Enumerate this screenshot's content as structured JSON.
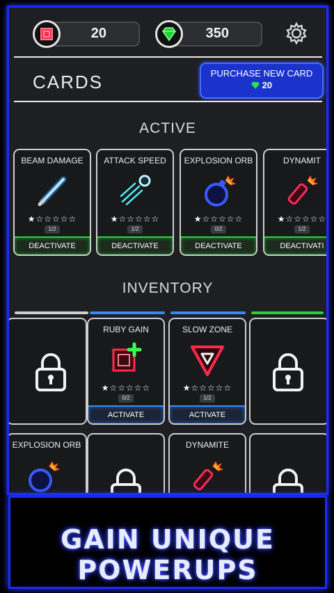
{
  "header": {
    "ruby_count": "20",
    "gem_count": "350",
    "ruby_icon": "ruby-icon",
    "gem_icon": "emerald-icon",
    "settings_icon": "gear-icon"
  },
  "page": {
    "title": "CARDS",
    "purchase_label": "PURCHASE NEW CARD",
    "purchase_cost": "20"
  },
  "active": {
    "heading": "ACTIVE",
    "cards": [
      {
        "name": "BEAM DAMAGE",
        "level": "1/2",
        "stars_filled": 1,
        "stars_total": 6,
        "button": "DEACTIVATE"
      },
      {
        "name": "ATTACK SPEED",
        "level": "1/2",
        "stars_filled": 1,
        "stars_total": 6,
        "button": "DEACTIVATE"
      },
      {
        "name": "EXPLOSION ORB",
        "level": "0/2",
        "stars_filled": 1,
        "stars_total": 6,
        "button": "DEACTIVATE"
      },
      {
        "name": "DYNAMIT",
        "level": "1/2",
        "stars_filled": 1,
        "stars_total": 6,
        "button": "DEACTIVATI"
      }
    ]
  },
  "inventory": {
    "heading": "INVENTORY",
    "cards": [
      {
        "name": "RUBY GAIN",
        "level": "0/2",
        "stars_filled": 1,
        "stars_total": 6,
        "button": "ACTIVATE"
      },
      {
        "name": "SLOW ZONE",
        "level": "1/2",
        "stars_filled": 1,
        "stars_total": 6,
        "button": "ACTIVATE"
      },
      {
        "name": "EXPLOSION ORB"
      },
      {
        "name": "DYNAMITE"
      }
    ]
  },
  "banner": {
    "text": "GAIN UNIQUE POWERUPS"
  },
  "colors": {
    "frame_blue": "#1a2bff",
    "active_green": "#26d23a",
    "inventory_blue": "#3a86ff"
  }
}
